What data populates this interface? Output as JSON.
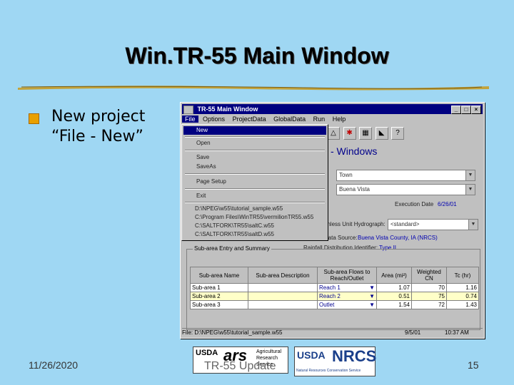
{
  "slide": {
    "title": "Win.TR-55 Main Window",
    "bullet_line1": "New project",
    "bullet_line2": "“File - New”",
    "date": "11/26/2020",
    "page_number": "15",
    "footer_text": "TR-55 Update",
    "accent_color": "#e9a000"
  },
  "logos": {
    "usda_ars_left": "USDA",
    "usda_ars_mid": "ars",
    "usda_ars_right_1": "Agricultural",
    "usda_ars_right_2": "Research",
    "usda_ars_right_3": "Service",
    "usda_nrcs_left": "USDA",
    "usda_nrcs_right": "NRCS",
    "usda_nrcs_sub": "Natural Resources Conservation Service"
  },
  "window": {
    "title": "TR-55 Main Window",
    "menu": [
      "File",
      "Options",
      "ProjectData",
      "GlobalData",
      "Run",
      "Help"
    ],
    "min_glyph": "_",
    "max_glyph": "□",
    "close_glyph": "×",
    "subtitle": "- Windows",
    "county_value": "Town",
    "state_value": "Buena Vista",
    "execution_date_label": "Execution Date",
    "execution_date_value": "6/26/01",
    "unit_hydrograph_label": "Dimensionless Unit Hydrograph:",
    "unit_hydrograph_value": "<standard>",
    "rainfall_source_label": "Rainfall Data Source:",
    "rainfall_source_value": "Buena Vista County, IA (NRCS)",
    "distribution_label": "Rainfall Distribution Identifier:",
    "distribution_value": "Type II",
    "group_title": "Sub-area Entry and Summary",
    "columns": [
      "Sub-area Name",
      "Sub-area Description",
      "Sub-area Flows to Reach/Outlet",
      "Area (mi²)",
      "Weighted CN",
      "Tc (hr)"
    ],
    "rows": [
      {
        "name": "Sub-area 1",
        "desc": "",
        "flows": "Reach 1",
        "area": "1.07",
        "cn": "70",
        "tc": "1.16"
      },
      {
        "name": "Sub-area 2",
        "desc": "",
        "flows": "Reach 2",
        "area": "0.51",
        "cn": "75",
        "tc": "0.74"
      },
      {
        "name": "Sub-area 3",
        "desc": "",
        "flows": "Outlet",
        "area": "1.54",
        "cn": "72",
        "tc": "1.43"
      }
    ],
    "status_file": "File: D:\\NPEG\\w55\\tutorial_sample.w55",
    "status_date": "9/5/01",
    "status_time": "10:37 AM"
  },
  "file_menu": {
    "items": [
      "New",
      "Open",
      "Save",
      "SaveAs",
      "Page Setup",
      "Exit"
    ],
    "recent": [
      "D:\\NPEG\\w55\\tutorial_sample.w55",
      "C:\\Program Files\\WinTR55\\vermilionTR55.w55",
      "C:\\SALTFORK\\TR55\\saltC.w55",
      "C:\\SALTFORK\\TR55\\saltD.w55"
    ]
  }
}
